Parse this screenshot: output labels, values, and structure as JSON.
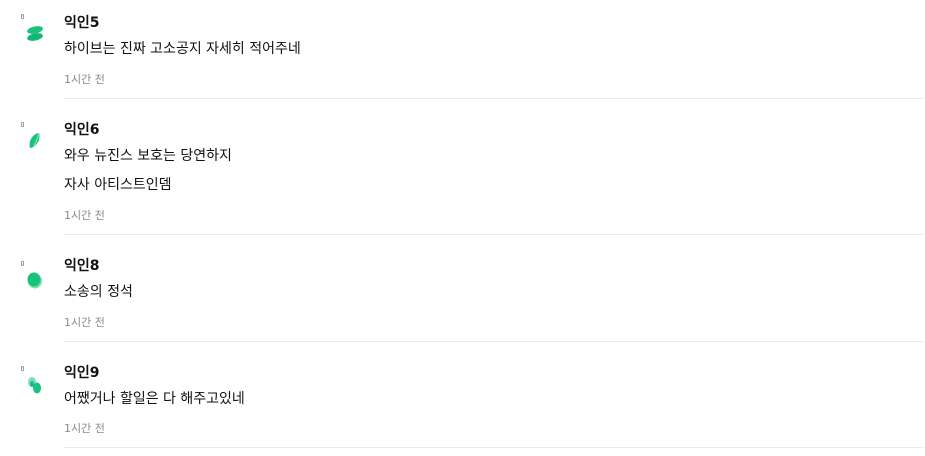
{
  "comments": [
    {
      "author": "익인5",
      "lines": [
        "하이브는 진짜 고소공지 자세히 적어주네"
      ],
      "time": "1시간 전",
      "avatar_icon": "stacked-green-pills-icon"
    },
    {
      "author": "익인6",
      "lines": [
        "와우 뉴진스 보호는 당연하지",
        "자사 아티스트인뎀"
      ],
      "time": "1시간 전",
      "avatar_icon": "green-leaf-icon"
    },
    {
      "author": "익인8",
      "lines": [
        "소송의 정석"
      ],
      "time": "1시간 전",
      "avatar_icon": "green-blob-icon"
    },
    {
      "author": "익인9",
      "lines": [
        "어쨌거나 할일은 다 해주고있네"
      ],
      "time": "1시간 전",
      "avatar_icon": "split-green-dots-icon"
    }
  ],
  "colors": {
    "avatar_green": "#19c37d",
    "avatar_light_green": "#7ee0a2",
    "avatar_teal": "#0fb8a6",
    "divider": "#e9e9e9",
    "time_text": "#8a8a8a"
  }
}
